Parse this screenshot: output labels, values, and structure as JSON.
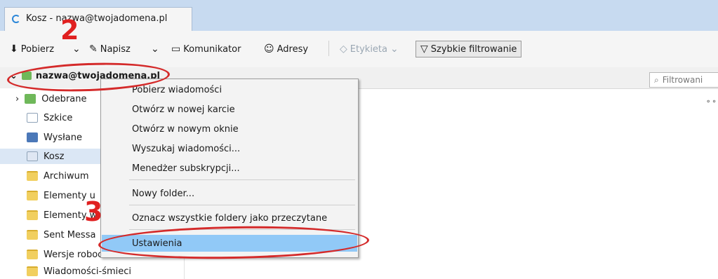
{
  "tab": {
    "title": "Kosz - nazwa@twojadomena.pl"
  },
  "toolbar": {
    "get_mail": "Pobierz",
    "write": "Napisz",
    "chat": "Komunikator",
    "address_book": "Adresy",
    "tag": "Etykieta",
    "quick_filter": "Szybkie filtrowanie"
  },
  "filter": {
    "placeholder": "Filtrowani"
  },
  "account": {
    "name": "nazwa@twojadomena.pl"
  },
  "folders": [
    "Odebrane",
    "Szkice",
    "Wysłane",
    "Kosz",
    "Archiwum",
    "Elementy u",
    "Elementy w",
    "Sent Messa",
    "Wersje robocze",
    "Wiadomości-śmieci"
  ],
  "context_menu": {
    "items": [
      "Pobierz wiadomości",
      "Otwórz w nowej karcie",
      "Otwórz w nowym oknie",
      "Wyszukaj wiadomości...",
      "Menedżer subskrypcji...",
      "Nowy folder...",
      "Oznacz wszystkie foldery jako przeczytane",
      "Ustawienia"
    ],
    "highlighted": "Ustawienia"
  },
  "annotations": {
    "step2": "2",
    "step3": "3"
  },
  "colors": {
    "annotation": "#d42a2a",
    "highlight": "#91c9f7",
    "selected_folder": "#dbe7f5"
  }
}
